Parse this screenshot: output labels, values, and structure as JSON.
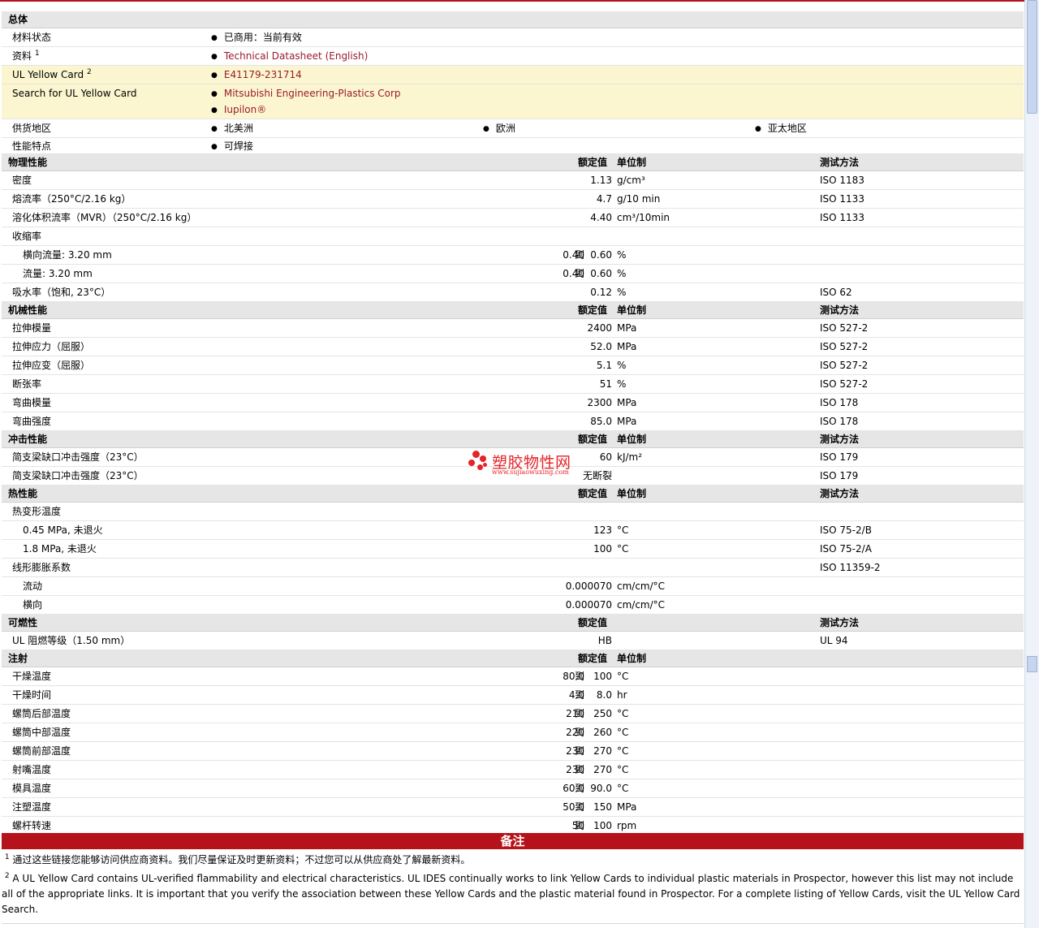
{
  "general": {
    "section": "总体",
    "material_status_label": "材料状态",
    "material_status_value": "已商用：当前有效",
    "literature_label": "资料",
    "literature_sup": "1",
    "literature_link": "Technical Datasheet (English)",
    "ul_card_label": "UL Yellow Card",
    "ul_card_sup": "2",
    "ul_card_link": "E41179-231714",
    "search_label": "Search for UL Yellow Card",
    "search_links": [
      "Mitsubishi Engineering-Plastics Corp",
      "Iupilon®"
    ],
    "availability_label": "供货地区",
    "availability": [
      "北美洲",
      "欧洲",
      "亚太地区"
    ],
    "features_label": "性能特点",
    "features_value": "可焊接"
  },
  "headers": {
    "rated": "额定值",
    "unit": "单位制",
    "method": "测试方法",
    "to": "到"
  },
  "physical": {
    "section": "物理性能",
    "rows": [
      {
        "label": "密度",
        "value": "1.13",
        "unit": "g/cm³",
        "method": "ISO 1183"
      },
      {
        "label": "熔流率（250°C/2.16 kg）",
        "value": "4.7",
        "unit": "g/10 min",
        "method": "ISO 1133"
      },
      {
        "label": "溶化体积流率（MVR）（250°C/2.16 kg）",
        "value": "4.40",
        "unit": "cm³/10min",
        "method": "ISO 1133"
      },
      {
        "label": "收缩率"
      },
      {
        "label": "横向流量: 3.20 mm",
        "from": "0.40",
        "to": "0.60",
        "unit": "%"
      },
      {
        "label": "流量: 3.20 mm",
        "from": "0.40",
        "to": "0.60",
        "unit": "%"
      },
      {
        "label": "吸水率（饱和, 23°C）",
        "value": "0.12",
        "unit": "%",
        "method": "ISO 62"
      }
    ]
  },
  "mechanical": {
    "section": "机械性能",
    "rows": [
      {
        "label": "拉伸模量",
        "value": "2400",
        "unit": "MPa",
        "method": "ISO 527-2"
      },
      {
        "label": "拉伸应力（屈服）",
        "value": "52.0",
        "unit": "MPa",
        "method": "ISO 527-2"
      },
      {
        "label": "拉伸应变（屈服）",
        "value": "5.1",
        "unit": "%",
        "method": "ISO 527-2"
      },
      {
        "label": "断张率",
        "value": "51",
        "unit": "%",
        "method": "ISO 527-2"
      },
      {
        "label": "弯曲模量",
        "value": "2300",
        "unit": "MPa",
        "method": "ISO 178"
      },
      {
        "label": "弯曲强度",
        "value": "85.0",
        "unit": "MPa",
        "method": "ISO 178"
      }
    ]
  },
  "impact": {
    "section": "冲击性能",
    "rows": [
      {
        "label": "简支梁缺口冲击强度（23°C）",
        "value": "60",
        "unit": "kJ/m²",
        "method": "ISO 179"
      },
      {
        "label": "简支梁缺口冲击强度（23°C）",
        "value": "无断裂",
        "unit": "",
        "method": "ISO 179"
      }
    ]
  },
  "thermal": {
    "section": "热性能",
    "rows": [
      {
        "label": "热变形温度"
      },
      {
        "label": "0.45 MPa, 未退火",
        "value": "123",
        "unit": "°C",
        "method": "ISO 75-2/B"
      },
      {
        "label": "1.8 MPa, 未退火",
        "value": "100",
        "unit": "°C",
        "method": "ISO 75-2/A"
      },
      {
        "label": "线形膨胀系数",
        "method": "ISO 11359-2"
      },
      {
        "label": "流动",
        "value": "0.000070",
        "unit": "cm/cm/°C"
      },
      {
        "label": "横向",
        "value": "0.000070",
        "unit": "cm/cm/°C"
      }
    ]
  },
  "flammability": {
    "section": "可燃性",
    "rows": [
      {
        "label": "UL 阻燃等级（1.50 mm）",
        "value": "HB",
        "method": "UL 94"
      }
    ]
  },
  "injection": {
    "section": "注射",
    "rows": [
      {
        "label": "干燥温度",
        "from": "80.0",
        "to": "100",
        "unit": "°C"
      },
      {
        "label": "干燥时间",
        "from": "4.0",
        "to": "8.0",
        "unit": "hr"
      },
      {
        "label": "螺筒后部温度",
        "from": "210",
        "to": "250",
        "unit": "°C"
      },
      {
        "label": "螺筒中部温度",
        "from": "220",
        "to": "260",
        "unit": "°C"
      },
      {
        "label": "螺筒前部温度",
        "from": "230",
        "to": "270",
        "unit": "°C"
      },
      {
        "label": "射嘴温度",
        "from": "230",
        "to": "270",
        "unit": "°C"
      },
      {
        "label": "模具温度",
        "from": "60.0",
        "to": "90.0",
        "unit": "°C"
      },
      {
        "label": "注塑温度",
        "from": "50.0",
        "to": "150",
        "unit": "MPa"
      },
      {
        "label": "螺杆转速",
        "from": "50",
        "to": "100",
        "unit": "rpm"
      }
    ]
  },
  "notes": {
    "title": "备注",
    "note1_sup": "1",
    "note1": "通过这些链接您能够访问供应商资料。我们尽量保证及时更新资料；不过您可以从供应商处了解最新资料。",
    "note2_sup": "2",
    "note2": "A UL Yellow Card contains UL-verified flammability and electrical characteristics. UL IDES continually works to link Yellow Cards to individual plastic materials in Prospector, however this list may not include all of the appropriate links. It is important that you verify the association between these Yellow Cards and the plastic material found in Prospector. For a complete listing of Yellow Cards, visit the UL Yellow Card Search."
  },
  "watermark": {
    "name": "塑胶物性网",
    "url": "www.sujiaowuxing.com"
  },
  "colors": {
    "accent": "#b5121b",
    "link": "#9b1b2c",
    "header_bg": "#e6e6e6",
    "yellow_bg": "#fbf6cf"
  }
}
